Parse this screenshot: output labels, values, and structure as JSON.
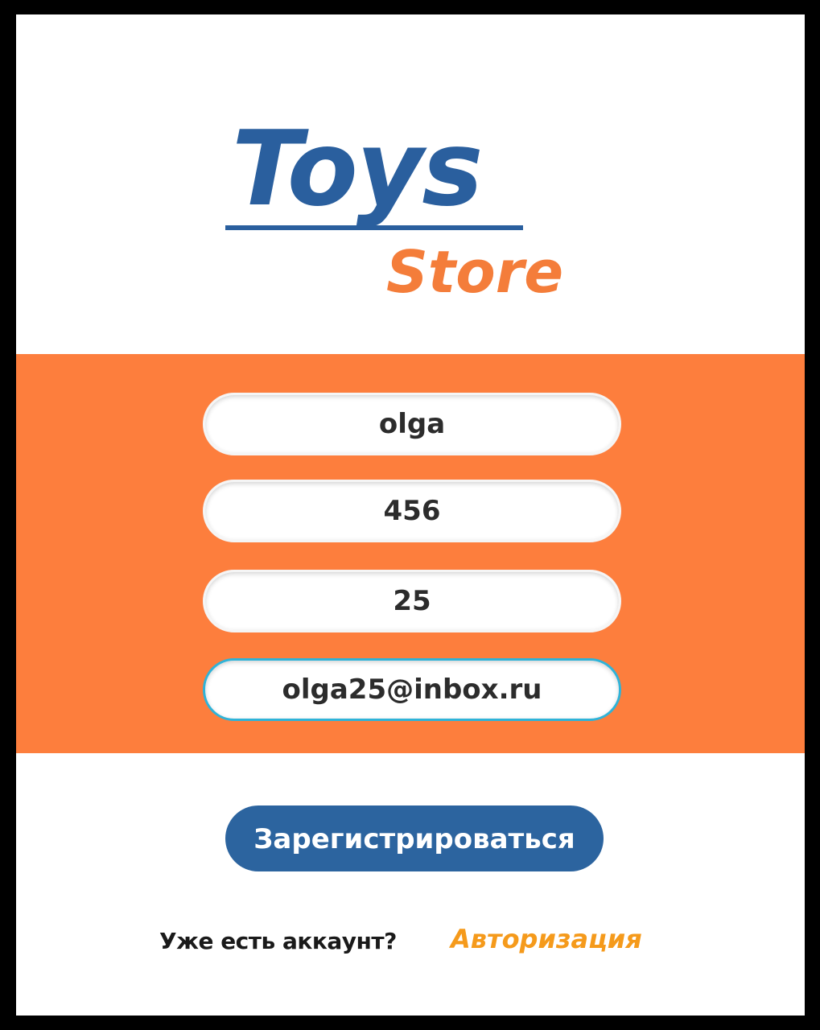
{
  "logo": {
    "title": "Toys",
    "subtitle": "Store"
  },
  "form": {
    "fields": [
      {
        "value": "olga"
      },
      {
        "value": "456"
      },
      {
        "value": "25"
      },
      {
        "value": "olga25@inbox.ru"
      }
    ],
    "register_label": "Зарегистрироваться"
  },
  "footer": {
    "prompt": "Уже есть аккаунт?",
    "login_link": "Авторизация"
  },
  "colors": {
    "brand_blue": "#2a5f9e",
    "brand_orange": "#f47d3a",
    "band_orange": "#fd7e3d",
    "button_blue": "#2c649f",
    "focus_border": "#2fb3d8",
    "link_orange": "#f59a1b"
  }
}
